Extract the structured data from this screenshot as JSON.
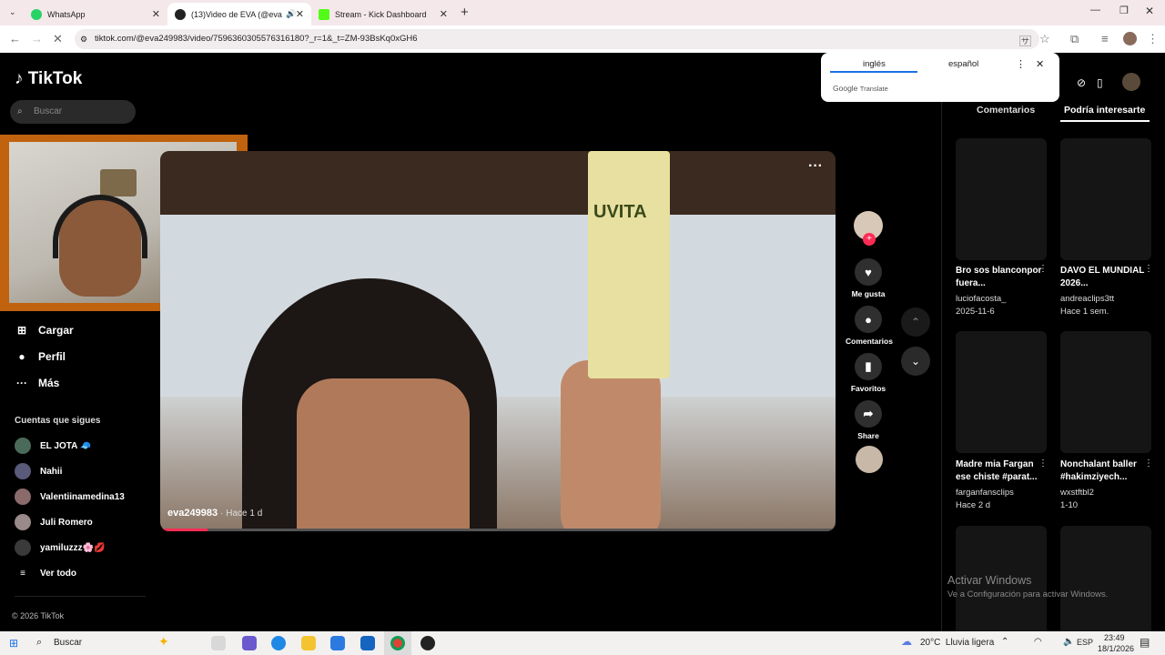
{
  "browser": {
    "tabs": [
      {
        "title": "WhatsApp",
        "color": "#25d366"
      },
      {
        "title": "(13)Video de EVA (@eva24",
        "color": "#222222"
      },
      {
        "title": "Stream - Kick Dashboard",
        "color": "#53fc18"
      }
    ],
    "url": "tiktok.com/@eva249983/video/7596360305576316180?_r=1&_t=ZM-93BsKq0xGH6"
  },
  "translate": {
    "lang_from": "inglés",
    "lang_to": "español",
    "brand": "Google",
    "product": "Translate"
  },
  "tiktok": {
    "logo": "TikTok",
    "search_placeholder": "Buscar",
    "nav": [
      {
        "label": "Cargar",
        "icon": "upload-icon"
      },
      {
        "label": "Perfil",
        "icon": "profile-icon"
      },
      {
        "label": "Más",
        "icon": "more-icon"
      }
    ],
    "following_title": "Cuentas que sigues",
    "following": [
      "EL JOTA 🧢",
      "Nahii",
      "Valentiinamedina13",
      "Juli Romero",
      "yamiluzzz🌸💋"
    ],
    "see_all": "Ver todo",
    "footer": "© 2026 TikTok",
    "video": {
      "author": "eva249983",
      "time": "Hace 1 d",
      "progress": 0.07,
      "carton_brand": "UVITA"
    },
    "actions": [
      "Me gusta",
      "Comentarios",
      "Favoritos",
      "Share"
    ],
    "right_tabs": [
      "Comentarios",
      "Podría interesarte"
    ],
    "suggestions": [
      {
        "title": "Bro sos blanconpor fuera...",
        "author": "luciofacosta_",
        "date": "2025-11-6"
      },
      {
        "title": "DAVO EL MUNDIAL 2026...",
        "author": "andreaclips3tt",
        "date": "Hace 1 sem."
      },
      {
        "title": "Madre mia Fargan ese chiste #parat...",
        "author": "farganfansclips",
        "date": "Hace 2 d"
      },
      {
        "title": "Nonchalant baller #hakimziyech...",
        "author": "wxstftbl2",
        "date": "1-10"
      }
    ],
    "activate_title": "Activar Windows",
    "activate_sub": "Ve a Configuración para activar Windows."
  },
  "taskbar": {
    "search": "Buscar",
    "weather": "20°C  Lluvia ligera",
    "lang": "ESP",
    "time": "23:49",
    "date": "18/1/2026"
  }
}
